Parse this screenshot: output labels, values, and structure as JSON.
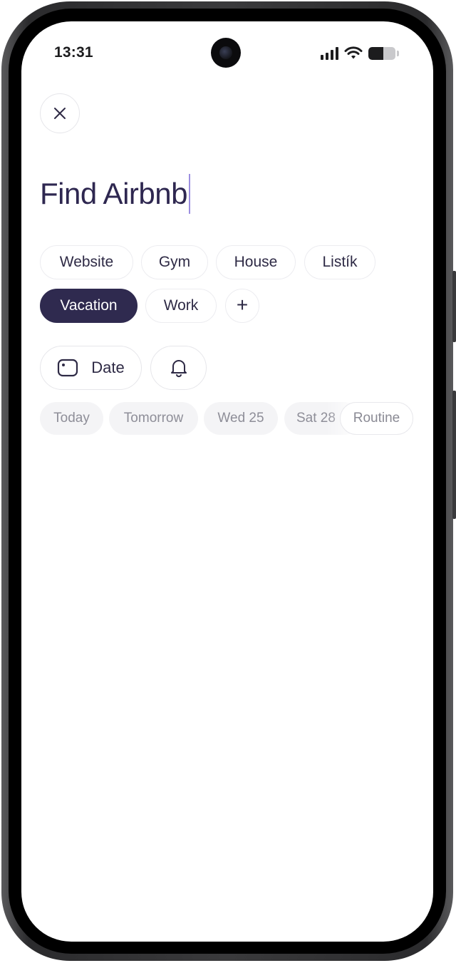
{
  "status_bar": {
    "time": "13:31"
  },
  "task": {
    "title": "Find Airbnb"
  },
  "tags": {
    "items": [
      {
        "label": "Website",
        "selected": false
      },
      {
        "label": "Gym",
        "selected": false
      },
      {
        "label": "House",
        "selected": false
      },
      {
        "label": "Listík",
        "selected": false
      },
      {
        "label": "Vacation",
        "selected": true
      },
      {
        "label": "Work",
        "selected": false
      }
    ],
    "add_label": "+"
  },
  "controls": {
    "date_label": "Date"
  },
  "quick_dates": {
    "items": [
      "Today",
      "Tomorrow",
      "Wed 25",
      "Sat 28"
    ],
    "routine_label": "Routine"
  },
  "icons": {
    "close": "close-icon",
    "calendar": "calendar-icon",
    "bell": "bell-icon"
  },
  "colors": {
    "accent": "#2f2a4f",
    "title_text": "#2e2750",
    "caret": "#9c8fe0",
    "muted_text": "#8e8e98"
  }
}
